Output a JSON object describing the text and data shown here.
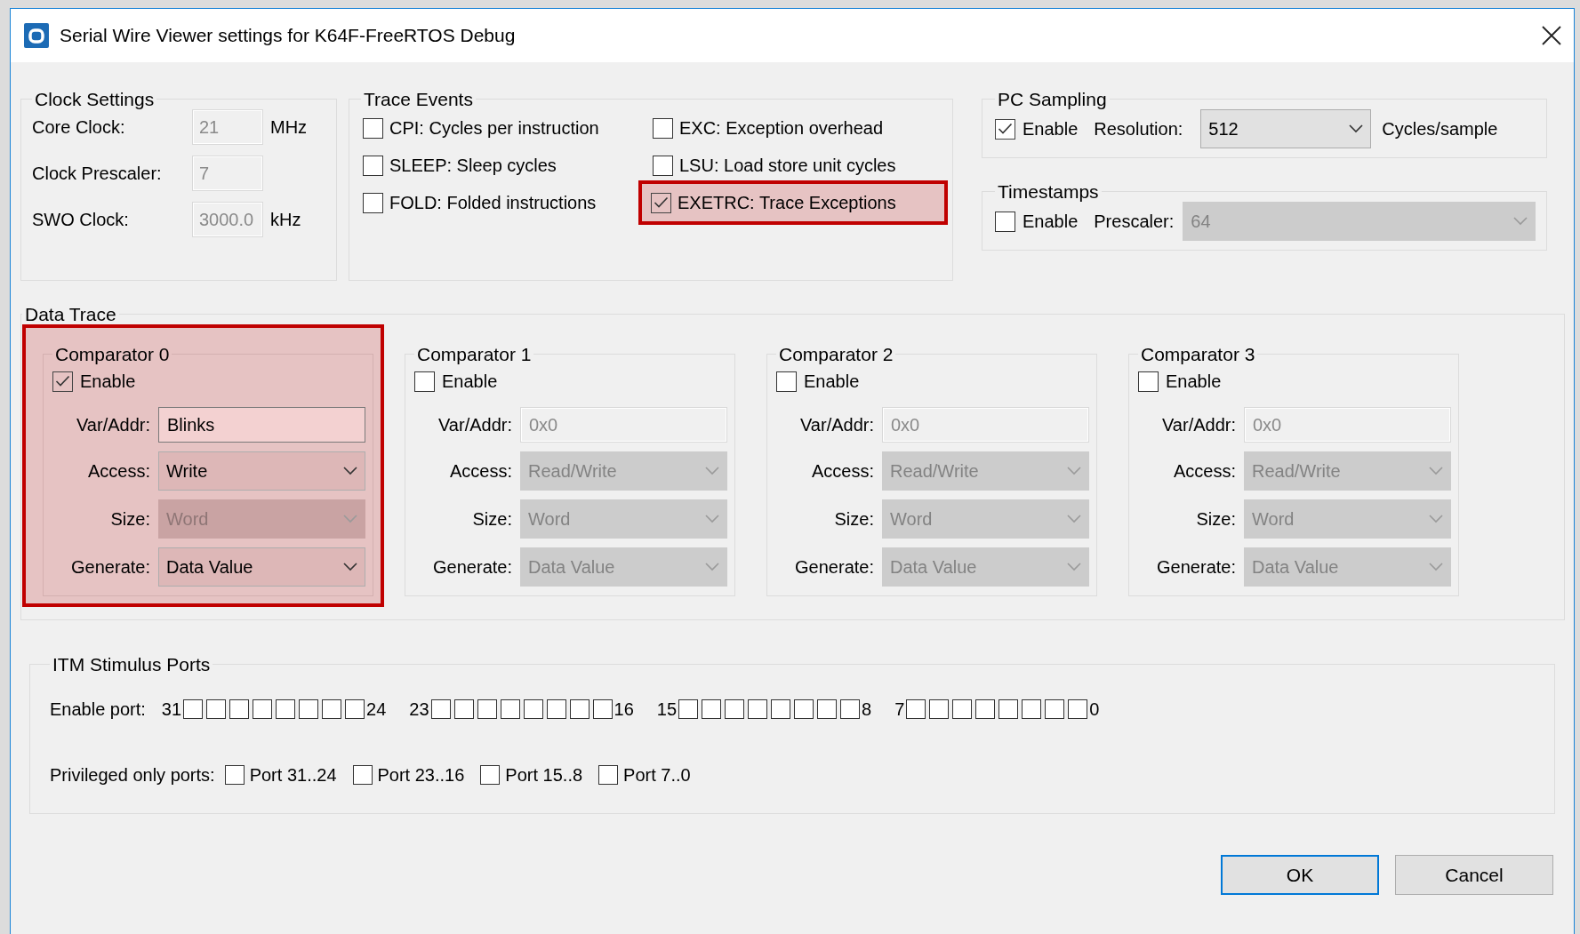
{
  "window": {
    "title": "Serial Wire Viewer settings for K64F-FreeRTOS Debug"
  },
  "clock_settings": {
    "title": "Clock Settings",
    "fields": [
      {
        "label": "Core Clock:",
        "value": "21",
        "unit": "MHz",
        "disabled": true
      },
      {
        "label": "Clock Prescaler:",
        "value": "7",
        "disabled": true
      },
      {
        "label": "SWO Clock:",
        "value": "3000.0",
        "unit": "kHz",
        "disabled": true
      }
    ]
  },
  "trace_events": {
    "title": "Trace Events",
    "items": [
      {
        "label": "CPI: Cycles per instruction",
        "checked": false,
        "highlighted": false
      },
      {
        "label": "EXC: Exception overhead",
        "checked": false,
        "highlighted": false
      },
      {
        "label": "SLEEP: Sleep cycles",
        "checked": false,
        "highlighted": false
      },
      {
        "label": "LSU: Load store unit cycles",
        "checked": false,
        "highlighted": false
      },
      {
        "label": "FOLD: Folded instructions",
        "checked": false,
        "highlighted": false
      },
      {
        "label": "EXETRC: Trace Exceptions",
        "checked": true,
        "highlighted": true
      }
    ]
  },
  "pc_sampling": {
    "title": "PC Sampling",
    "enable": {
      "label": "Enable",
      "checked": true
    },
    "resolution_label": "Resolution:",
    "resolution": {
      "value": "512",
      "disabled": false
    },
    "unit": "Cycles/sample"
  },
  "timestamps": {
    "title": "Timestamps",
    "enable": {
      "label": "Enable",
      "checked": false
    },
    "prescaler_label": "Prescaler:",
    "prescaler": {
      "value": "64",
      "disabled": true
    }
  },
  "data_trace": {
    "title": "Data Trace",
    "comparators": [
      {
        "title": "Comparator 0",
        "highlighted": true,
        "enable": {
          "label": "Enable",
          "checked": true
        },
        "fields": [
          {
            "kind": "text",
            "label": "Var/Addr:",
            "value": "Blinks",
            "disabled": false
          },
          {
            "kind": "select",
            "label": "Access:",
            "value": "Write",
            "disabled": false
          },
          {
            "kind": "select",
            "label": "Size:",
            "value": "Word",
            "disabled": true
          },
          {
            "kind": "select",
            "label": "Generate:",
            "value": "Data Value",
            "disabled": false
          }
        ]
      },
      {
        "title": "Comparator 1",
        "highlighted": false,
        "enable": {
          "label": "Enable",
          "checked": false
        },
        "fields": [
          {
            "kind": "text",
            "label": "Var/Addr:",
            "value": "0x0",
            "disabled": true
          },
          {
            "kind": "select",
            "label": "Access:",
            "value": "Read/Write",
            "disabled": true
          },
          {
            "kind": "select",
            "label": "Size:",
            "value": "Word",
            "disabled": true
          },
          {
            "kind": "select",
            "label": "Generate:",
            "value": "Data Value",
            "disabled": true
          }
        ]
      },
      {
        "title": "Comparator 2",
        "highlighted": false,
        "enable": {
          "label": "Enable",
          "checked": false
        },
        "fields": [
          {
            "kind": "text",
            "label": "Var/Addr:",
            "value": "0x0",
            "disabled": true
          },
          {
            "kind": "select",
            "label": "Access:",
            "value": "Read/Write",
            "disabled": true
          },
          {
            "kind": "select",
            "label": "Size:",
            "value": "Word",
            "disabled": true
          },
          {
            "kind": "select",
            "label": "Generate:",
            "value": "Data Value",
            "disabled": true
          }
        ]
      },
      {
        "title": "Comparator 3",
        "highlighted": false,
        "enable": {
          "label": "Enable",
          "checked": false
        },
        "fields": [
          {
            "kind": "text",
            "label": "Var/Addr:",
            "value": "0x0",
            "disabled": true
          },
          {
            "kind": "select",
            "label": "Access:",
            "value": "Read/Write",
            "disabled": true
          },
          {
            "kind": "select",
            "label": "Size:",
            "value": "Word",
            "disabled": true
          },
          {
            "kind": "select",
            "label": "Generate:",
            "value": "Data Value",
            "disabled": true
          }
        ]
      }
    ]
  },
  "itm_stimulus_ports": {
    "title": "ITM Stimulus Ports",
    "enable_label": "Enable port:",
    "groups": [
      {
        "high": "31",
        "low": "24",
        "ports": [
          {
            "checked": false
          },
          {
            "checked": false
          },
          {
            "checked": false
          },
          {
            "checked": false
          },
          {
            "checked": false
          },
          {
            "checked": false
          },
          {
            "checked": false
          },
          {
            "checked": false
          }
        ]
      },
      {
        "high": "23",
        "low": "16",
        "ports": [
          {
            "checked": false
          },
          {
            "checked": false
          },
          {
            "checked": false
          },
          {
            "checked": false
          },
          {
            "checked": false
          },
          {
            "checked": false
          },
          {
            "checked": false
          },
          {
            "checked": false
          }
        ]
      },
      {
        "high": "15",
        "low": "8",
        "ports": [
          {
            "checked": false
          },
          {
            "checked": false
          },
          {
            "checked": false
          },
          {
            "checked": false
          },
          {
            "checked": false
          },
          {
            "checked": false
          },
          {
            "checked": false
          },
          {
            "checked": false
          }
        ]
      },
      {
        "high": "7",
        "low": "0",
        "ports": [
          {
            "checked": false
          },
          {
            "checked": false
          },
          {
            "checked": false
          },
          {
            "checked": false
          },
          {
            "checked": false
          },
          {
            "checked": false
          },
          {
            "checked": false
          },
          {
            "checked": false
          }
        ]
      }
    ],
    "privileged_label": "Privileged only ports:",
    "privileged": [
      {
        "label": "Port 31..24",
        "checked": false
      },
      {
        "label": "Port 23..16",
        "checked": false
      },
      {
        "label": "Port 15..8",
        "checked": false
      },
      {
        "label": "Port 7..0",
        "checked": false
      }
    ]
  },
  "buttons": [
    {
      "label": "OK",
      "default": true
    },
    {
      "label": "Cancel",
      "default": false
    }
  ]
}
